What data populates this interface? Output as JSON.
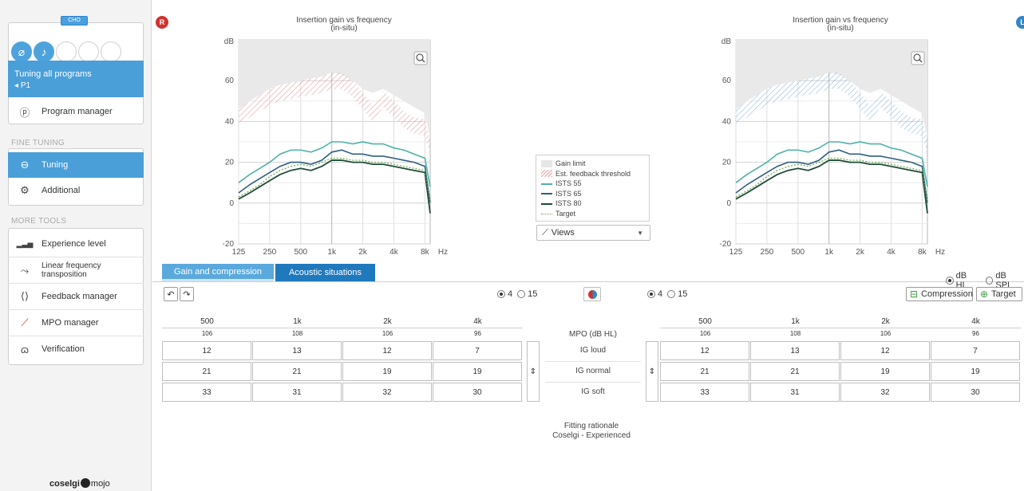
{
  "sidebar": {
    "device_badge": "CHO",
    "tuning_all": {
      "title": "Tuning all programs",
      "program": "P1"
    },
    "program_manager": "Program manager",
    "fine_tuning_label": "FINE TUNING",
    "fine_tuning_items": [
      "Tuning",
      "Additional"
    ],
    "more_tools_label": "MORE TOOLS",
    "more_tools_items": [
      "Experience level",
      "Linear frequency\ntransposition",
      "Feedback manager",
      "MPO manager",
      "Verification"
    ],
    "logo_left": "coselgi",
    "logo_right": "mojo"
  },
  "colors": {
    "accent": "#4a9fd8",
    "right_ear": "#d0332f",
    "left_ear": "#2f86c8",
    "ists55": "#4db3a8",
    "ists65": "#2f5f80",
    "ists80": "#1f4a38",
    "target": "#6aa84f"
  },
  "badges": {
    "right": "R",
    "left": "L"
  },
  "charts": {
    "right": {
      "title": "Insertion gain vs frequency",
      "subtitle": "(in-situ)"
    },
    "left": {
      "title": "Insertion gain vs frequency",
      "subtitle": "(in-situ)"
    }
  },
  "chart_data": [
    {
      "type": "line",
      "title": "Insertion gain vs frequency (in-situ)",
      "ear": "right",
      "ylabel": "dB",
      "xlabel": "Hz",
      "ylim": [
        -20,
        80
      ],
      "yticks": [
        -20,
        0,
        20,
        40,
        60
      ],
      "xticks": [
        "125",
        "250",
        "500",
        "1k",
        "2k",
        "4k",
        "8k"
      ],
      "x": [
        125,
        160,
        200,
        250,
        315,
        400,
        500,
        630,
        800,
        1000,
        1250,
        1600,
        2000,
        2500,
        3150,
        4000,
        5000,
        6300,
        8000,
        9000
      ],
      "series": [
        {
          "name": "Gain limit",
          "values": [
            46,
            50,
            53,
            56,
            58,
            59,
            60,
            61,
            62,
            64,
            63,
            60,
            56,
            54,
            56,
            53,
            50,
            47,
            44,
            32
          ]
        },
        {
          "name": "Est. feedback threshold",
          "values": [
            46,
            50,
            53,
            56,
            58,
            59,
            60,
            61,
            62,
            64,
            64,
            60,
            54,
            48,
            55,
            50,
            45,
            42,
            41,
            32
          ]
        },
        {
          "name": "ISTS 55",
          "values": [
            10,
            14,
            17,
            20,
            24,
            26,
            26,
            25,
            27,
            30,
            30,
            29,
            30,
            29,
            29,
            27,
            26,
            24,
            22,
            8
          ]
        },
        {
          "name": "ISTS 65",
          "values": [
            5,
            9,
            12,
            15,
            18,
            20,
            20,
            19,
            21,
            25,
            26,
            24,
            24,
            23,
            23,
            22,
            21,
            20,
            18,
            0
          ]
        },
        {
          "name": "ISTS 80",
          "values": [
            2,
            5,
            8,
            11,
            14,
            16,
            17,
            16,
            18,
            21,
            21,
            20,
            20,
            19,
            19,
            18,
            17,
            16,
            15,
            -5
          ]
        },
        {
          "name": "Target",
          "values": [
            3,
            6,
            9,
            13,
            16,
            18,
            19,
            18,
            20,
            22,
            22,
            21,
            21,
            20,
            20,
            19,
            18,
            17,
            16,
            0
          ]
        }
      ]
    },
    {
      "type": "line",
      "title": "Insertion gain vs frequency (in-situ)",
      "ear": "left",
      "ylabel": "dB",
      "xlabel": "Hz",
      "ylim": [
        -20,
        80
      ],
      "yticks": [
        -20,
        0,
        20,
        40,
        60
      ],
      "xticks": [
        "125",
        "250",
        "500",
        "1k",
        "2k",
        "4k",
        "8k"
      ],
      "x": [
        125,
        160,
        200,
        250,
        315,
        400,
        500,
        630,
        800,
        1000,
        1250,
        1600,
        2000,
        2500,
        3150,
        4000,
        5000,
        6300,
        8000,
        9000
      ],
      "series": [
        {
          "name": "Gain limit",
          "values": [
            46,
            50,
            53,
            56,
            58,
            59,
            60,
            61,
            62,
            64,
            63,
            60,
            56,
            54,
            56,
            53,
            50,
            47,
            44,
            32
          ]
        },
        {
          "name": "Est. feedback threshold",
          "values": [
            46,
            50,
            53,
            56,
            58,
            59,
            60,
            61,
            62,
            64,
            64,
            60,
            54,
            48,
            55,
            50,
            45,
            42,
            41,
            32
          ]
        },
        {
          "name": "ISTS 55",
          "values": [
            10,
            14,
            17,
            20,
            24,
            26,
            26,
            25,
            27,
            30,
            30,
            29,
            30,
            29,
            29,
            27,
            26,
            24,
            22,
            8
          ]
        },
        {
          "name": "ISTS 65",
          "values": [
            5,
            9,
            12,
            15,
            18,
            20,
            20,
            19,
            21,
            25,
            26,
            24,
            24,
            23,
            23,
            22,
            21,
            20,
            18,
            0
          ]
        },
        {
          "name": "ISTS 80",
          "values": [
            2,
            5,
            8,
            11,
            14,
            16,
            17,
            16,
            18,
            21,
            21,
            20,
            20,
            19,
            19,
            18,
            17,
            16,
            15,
            -5
          ]
        },
        {
          "name": "Target",
          "values": [
            3,
            6,
            9,
            13,
            16,
            18,
            19,
            18,
            20,
            22,
            22,
            21,
            21,
            20,
            20,
            19,
            18,
            17,
            16,
            0
          ]
        }
      ]
    }
  ],
  "legend": [
    "Gain limit",
    "Est. feedback threshold",
    "ISTS 55",
    "ISTS 65",
    "ISTS 80",
    "Target"
  ],
  "views_dropdown": "Views",
  "tabs": [
    "Gain and compression",
    "Acoustic situations"
  ],
  "units": {
    "options": [
      "dB HL",
      "dB SPL"
    ],
    "selected": "dB HL"
  },
  "channels": {
    "options": [
      "4",
      "15"
    ],
    "selected": "4"
  },
  "buttons": {
    "compression": "Compression",
    "target": "Target"
  },
  "table": {
    "frequencies": [
      "500",
      "1k",
      "2k",
      "4k"
    ],
    "mpo_label": "MPO (dB HL)",
    "right": {
      "mpo": [
        "106",
        "108",
        "106",
        "96"
      ],
      "rows": [
        {
          "label": "IG loud",
          "values": [
            "12",
            "13",
            "12",
            "7"
          ]
        },
        {
          "label": "IG normal",
          "values": [
            "21",
            "21",
            "19",
            "19"
          ]
        },
        {
          "label": "IG soft",
          "values": [
            "33",
            "31",
            "32",
            "30"
          ]
        }
      ]
    },
    "left": {
      "mpo": [
        "106",
        "108",
        "106",
        "96"
      ],
      "rows": [
        {
          "label": "IG loud",
          "values": [
            "12",
            "13",
            "12",
            "7"
          ]
        },
        {
          "label": "IG normal",
          "values": [
            "21",
            "21",
            "19",
            "19"
          ]
        },
        {
          "label": "IG soft",
          "values": [
            "33",
            "31",
            "32",
            "30"
          ]
        }
      ]
    }
  },
  "rationale": {
    "label": "Fitting rationale",
    "value": "Coselgi - Experienced"
  }
}
